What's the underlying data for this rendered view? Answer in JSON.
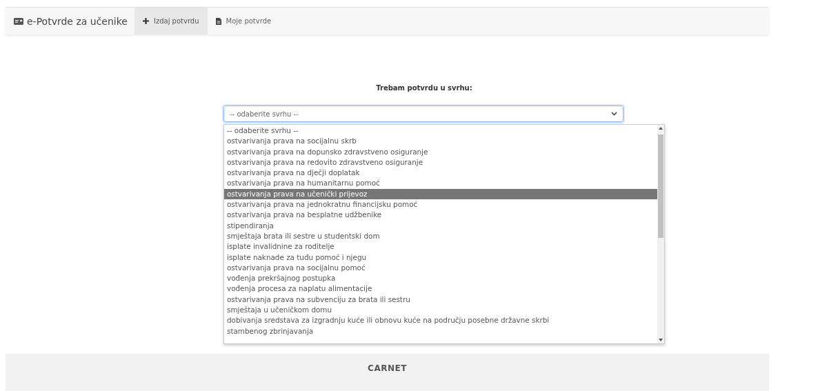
{
  "navbar": {
    "brand": "e-Potvrde za učenike",
    "tabs": [
      {
        "label": "Izdaj potvrdu",
        "kind": "plus",
        "selected": true
      },
      {
        "label": "Moje potvrde",
        "kind": "document",
        "selected": false
      }
    ]
  },
  "form": {
    "label": "Trebam potvrdu u svrhu:",
    "select": {
      "value": "-- odaberite svrhu --",
      "expanded": true
    },
    "options": [
      {
        "label": "-- odaberite svrhu --",
        "selected": false
      },
      {
        "label": "ostvarivanja prava na socijalnu skrb",
        "selected": false
      },
      {
        "label": "ostvarivanja prava na dopunsko zdravstveno osiguranje",
        "selected": false
      },
      {
        "label": "ostvarivanja prava na redovito zdravstveno osiguranje",
        "selected": false
      },
      {
        "label": "ostvarivanja prava na dječji doplatak",
        "selected": false
      },
      {
        "label": "ostvarivanja prava na humanitarnu pomoć",
        "selected": false
      },
      {
        "label": "ostvarivanja prava na učenički prijevoz",
        "selected": true
      },
      {
        "label": "ostvarivanja prava na jednokratnu financijsku pomoć",
        "selected": false
      },
      {
        "label": "ostvarivanja prava na besplatne udžbenike",
        "selected": false
      },
      {
        "label": "stipendiranja",
        "selected": false
      },
      {
        "label": "smještaja brata ili sestre u studentski dom",
        "selected": false
      },
      {
        "label": "isplate invalidnine za roditelje",
        "selected": false
      },
      {
        "label": "isplate naknade za tuđu pomoć i njegu",
        "selected": false
      },
      {
        "label": "ostvarivanja prava na socijalnu pomoć",
        "selected": false
      },
      {
        "label": "vođenja prekršajnog postupka",
        "selected": false
      },
      {
        "label": "vođenja procesa za naplatu alimentacije",
        "selected": false
      },
      {
        "label": "ostvarivanja prava na subvenciju za brata ili sestru",
        "selected": false
      },
      {
        "label": "smještaja u učeničkom domu",
        "selected": false
      },
      {
        "label": "dobivanja sredstava za izgradnju kuće ili obnovu kuće na području posebne državne skrbi",
        "selected": false
      },
      {
        "label": "stambenog zbrinjavanja",
        "selected": false
      }
    ]
  },
  "footer": {
    "logo": "CARNET"
  }
}
